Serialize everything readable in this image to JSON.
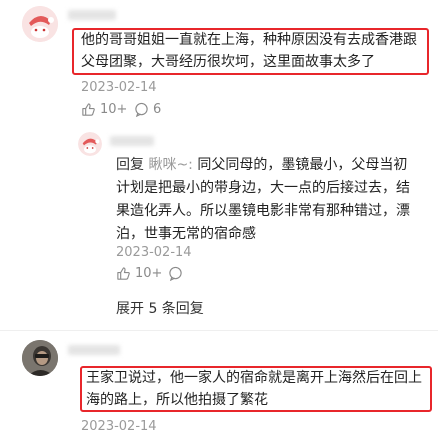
{
  "comment1": {
    "avatar_icon": "santa-hat-avatar",
    "text_lines": [
      "他的哥哥姐姐一直就在上海，种种原因没有去成香港跟",
      "父母团聚，大哥经历很坎坷，这里面故事太多了"
    ],
    "date": "2023-02-14",
    "likes": "10+",
    "replies": "6"
  },
  "reply1": {
    "avatar_icon": "santa-hat-avatar",
    "prefix": "回复",
    "reply_to": "瞅咪~:",
    "text_lines": [
      "同父同母的，墨镜最小，父母当初",
      "计划是把最小的带身边，大一点的后接过去，结",
      "果造化弄人。所以墨镜电影非常有那种错过，漂",
      "泊，世事无常的宿命感"
    ],
    "date": "2023-02-14",
    "likes": "10+"
  },
  "expand_link": "展开 5 条回复",
  "comment2": {
    "avatar_icon": "portrait-avatar",
    "text_lines": [
      "王家卫说过，他一家人的宿命就是离开上海然后在回上",
      "海的路上，所以他拍摄了繁花"
    ],
    "date": "2023-02-14"
  },
  "colors": {
    "highlight": "#e8262b",
    "meta": "#9a9a9a"
  }
}
